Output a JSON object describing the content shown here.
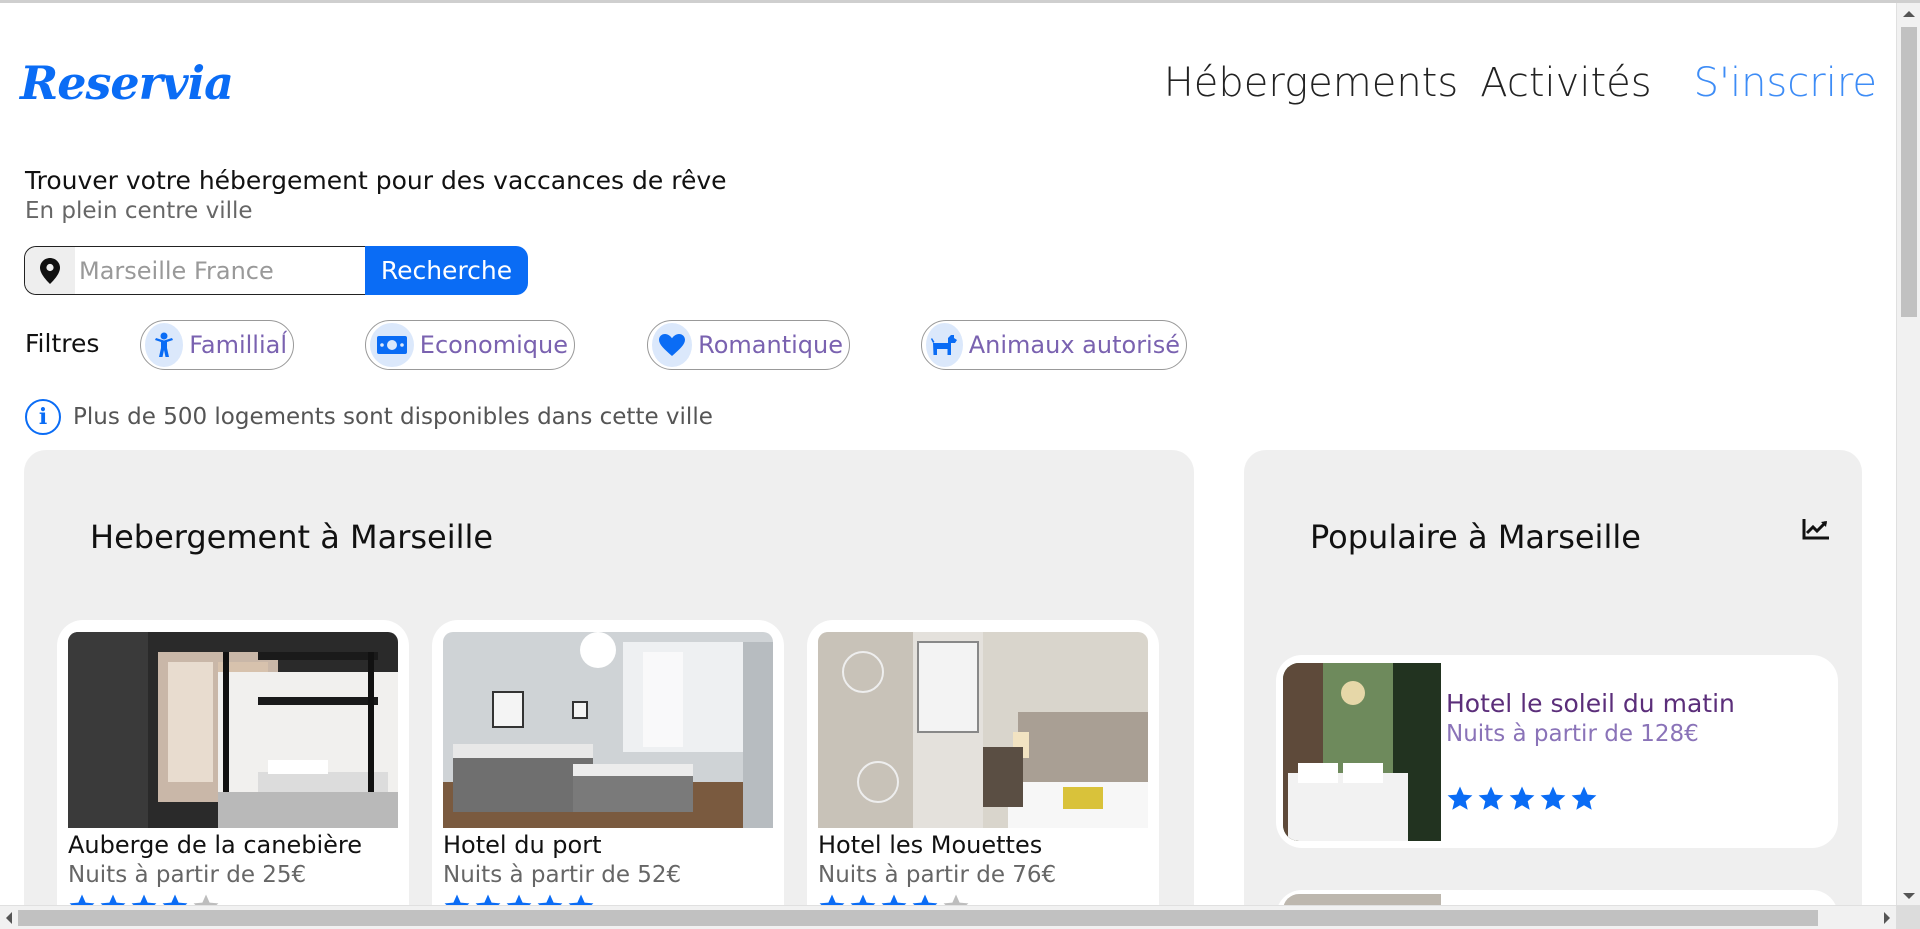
{
  "header": {
    "logo": "Reservia",
    "nav": [
      {
        "label": "Hébergements"
      },
      {
        "label": "Activités"
      },
      {
        "label": "S'inscrire"
      }
    ]
  },
  "hero": {
    "title": "Trouver votre hébergement pour des vaccances de rêve",
    "subtitle": "En plein centre ville"
  },
  "search": {
    "placeholder": "Marseille France",
    "button": "Recherche",
    "icon": "map-pin-icon"
  },
  "filters": {
    "label": "Filtres",
    "items": [
      {
        "label": "Familliaĺ",
        "icon": "child-icon"
      },
      {
        "label": "Economique",
        "icon": "money-icon"
      },
      {
        "label": "Romantique",
        "icon": "heart-icon"
      },
      {
        "label": "Animaux autorisé",
        "icon": "dog-icon"
      }
    ]
  },
  "info": {
    "text": "Plus de 500 logements sont disponibles dans cette ville",
    "icon": "info-icon"
  },
  "accommodations": {
    "title": "Hebergement à Marseille",
    "cards": [
      {
        "name": "Auberge de la canebière",
        "price": "Nuits à partir de 25€",
        "rating": 4
      },
      {
        "name": "Hotel du port",
        "price": "Nuits à partir de 52€",
        "rating": 5
      },
      {
        "name": "Hotel les Mouettes",
        "price": "Nuits à partir de 76€",
        "rating": 4
      }
    ]
  },
  "popular": {
    "title": "Populaire à Marseille",
    "icon": "trend-chart-icon",
    "cards": [
      {
        "name": "Hotel le soleil du matin",
        "price": "Nuits à partir de 128€",
        "rating": 5
      }
    ]
  },
  "colors": {
    "accent": "#0a6cf5",
    "star_on": "#0a6cf5",
    "star_off": "#bdbdbd",
    "panel_bg": "#efefef"
  }
}
